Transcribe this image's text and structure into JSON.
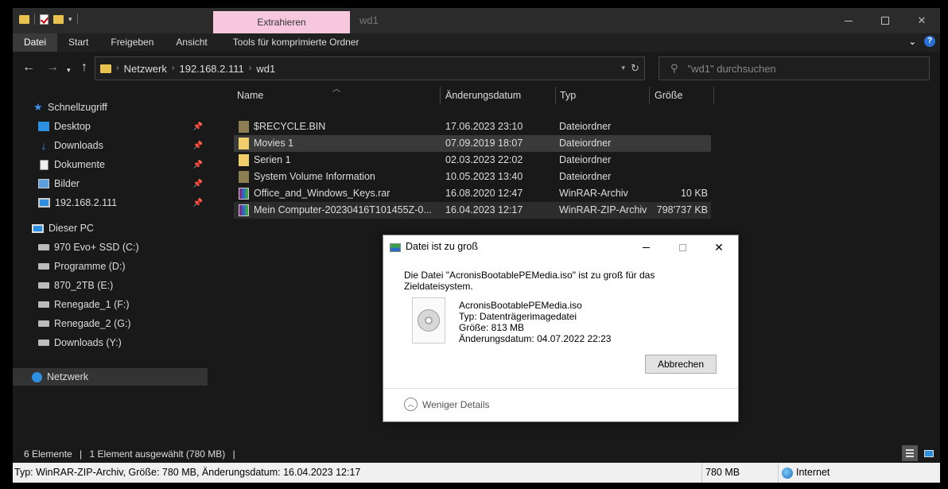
{
  "window": {
    "context_tab": "Extrahieren",
    "title": "wd1"
  },
  "ribbon": {
    "tabs": [
      "Datei",
      "Start",
      "Freigeben",
      "Ansicht",
      "Tools für komprimierte Ordner"
    ]
  },
  "address": {
    "crumbs": [
      "Netzwerk",
      "192.168.2.111",
      "wd1"
    ],
    "search_placeholder": "\"wd1\" durchsuchen"
  },
  "navpane": {
    "quick_access": "Schnellzugriff",
    "pinned": [
      "Desktop",
      "Downloads",
      "Dokumente",
      "Bilder",
      "192.168.2.111"
    ],
    "this_pc": "Dieser PC",
    "drives": [
      "970 Evo+ SSD (C:)",
      "Programme (D:)",
      "870_2TB (E:)",
      "Renegade_1 (F:)",
      "Renegade_2 (G:)",
      "Downloads (Y:)"
    ],
    "network": "Netzwerk"
  },
  "columns": {
    "name": "Name",
    "date": "Änderungsdatum",
    "type": "Typ",
    "size": "Größe"
  },
  "files": [
    {
      "name": "$RECYCLE.BIN",
      "date": "17.06.2023 23:10",
      "type": "Dateiordner",
      "size": ""
    },
    {
      "name": "Movies 1",
      "date": "07.09.2019 18:07",
      "type": "Dateiordner",
      "size": ""
    },
    {
      "name": "Serien 1",
      "date": "02.03.2023 22:02",
      "type": "Dateiordner",
      "size": ""
    },
    {
      "name": "System Volume Information",
      "date": "10.05.2023 13:40",
      "type": "Dateiordner",
      "size": ""
    },
    {
      "name": "Office_and_Windows_Keys.rar",
      "date": "16.08.2020 12:47",
      "type": "WinRAR-Archiv",
      "size": "10 KB"
    },
    {
      "name": "Mein Computer-20230416T101455Z-0...",
      "date": "16.04.2023 12:17",
      "type": "WinRAR-ZIP-Archiv",
      "size": "798'737 KB"
    }
  ],
  "status": {
    "count": "6 Elemente",
    "selection": "1 Element ausgewählt (780 MB)"
  },
  "detailbar": {
    "info": "Typ: WinRAR-ZIP-Archiv, Größe: 780 MB, Änderungsdatum: 16.04.2023 12:17",
    "size": "780 MB",
    "zone": "Internet"
  },
  "dialog": {
    "title": "Datei ist zu groß",
    "message": "Die Datei \"AcronisBootablePEMedia.iso\" ist zu groß für das Zieldateisystem.",
    "file_name": "AcronisBootablePEMedia.iso",
    "file_type": "Typ: Datenträgerimagedatei",
    "file_size": "Größe: 813 MB",
    "file_date": "Änderungsdatum: 04.07.2022 22:23",
    "cancel": "Abbrechen",
    "less_details": "Weniger Details"
  }
}
